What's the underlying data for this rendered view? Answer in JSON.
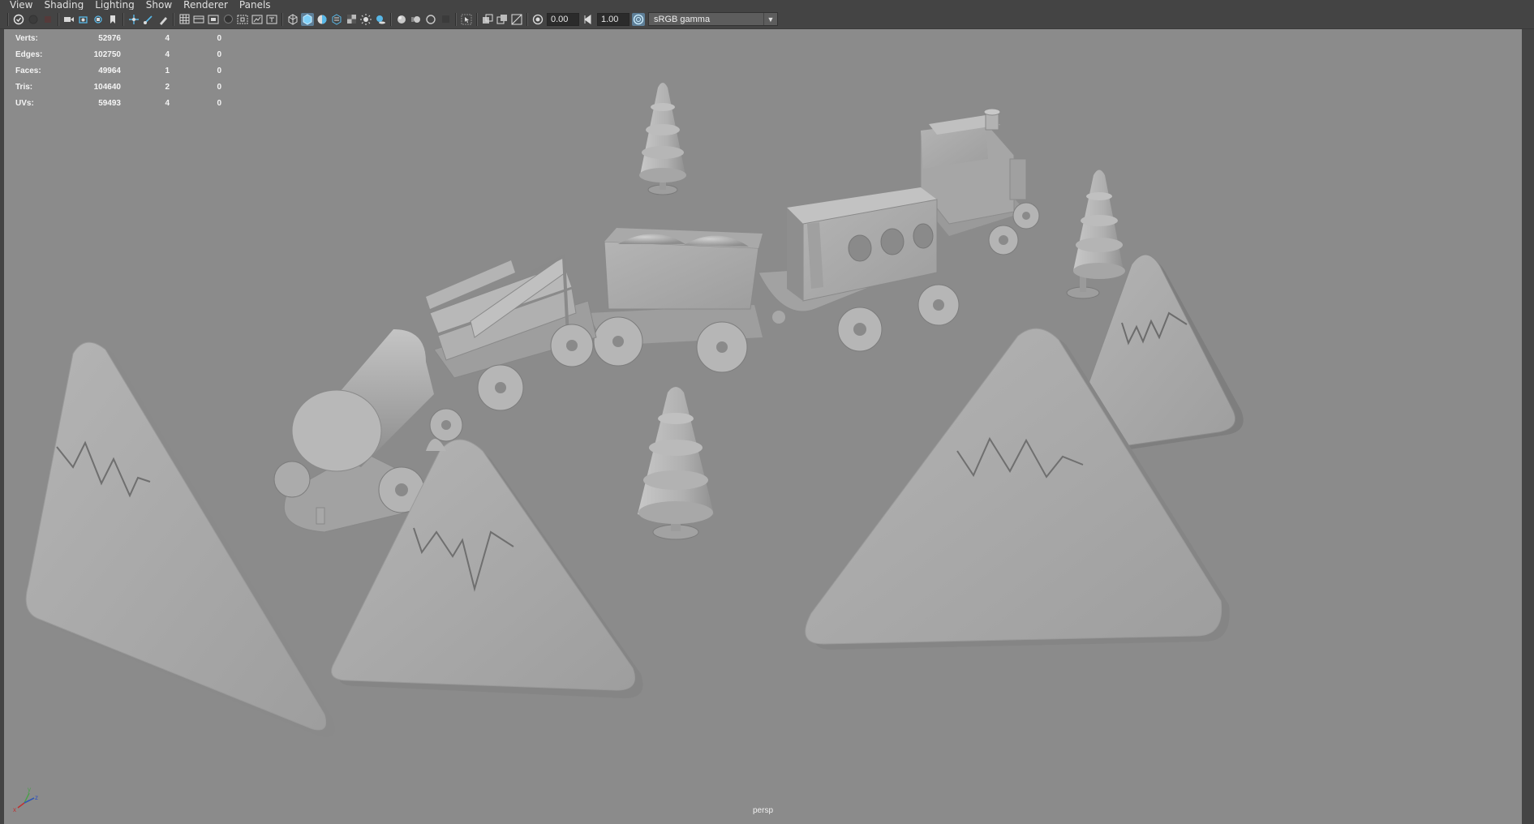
{
  "menubar": {
    "items": [
      "View",
      "Shading",
      "Lighting",
      "Show",
      "Renderer",
      "Panels"
    ]
  },
  "toolbar": {
    "exposure_value": "0.00",
    "gamma_value": "1.00",
    "color_space": "sRGB gamma",
    "icons": {
      "select_camera": "camera-select-icon",
      "wireframe": "wireframe-icon",
      "smooth_shade": "smooth-shade-icon",
      "isolate": "isolate-select-icon",
      "grid": "grid-icon",
      "resolution_gate": "resolution-gate-icon",
      "exposure": "exposure-icon",
      "gamma": "gamma-icon",
      "color_management": "color-management-icon"
    },
    "accent_color": "#5e7f98"
  },
  "hud": {
    "rows": [
      {
        "label": "Verts:",
        "total": "52976",
        "selected": "4",
        "component": "0"
      },
      {
        "label": "Edges:",
        "total": "102750",
        "selected": "4",
        "component": "0"
      },
      {
        "label": "Faces:",
        "total": "49964",
        "selected": "1",
        "component": "0"
      },
      {
        "label": "Tris:",
        "total": "104640",
        "selected": "2",
        "component": "0"
      },
      {
        "label": "UVs:",
        "total": "59493",
        "selected": "4",
        "component": "0"
      }
    ]
  },
  "viewport": {
    "camera": "persp",
    "background_color": "#8b8b8b",
    "axes": {
      "x": "x",
      "y": "y",
      "z": "z"
    }
  }
}
